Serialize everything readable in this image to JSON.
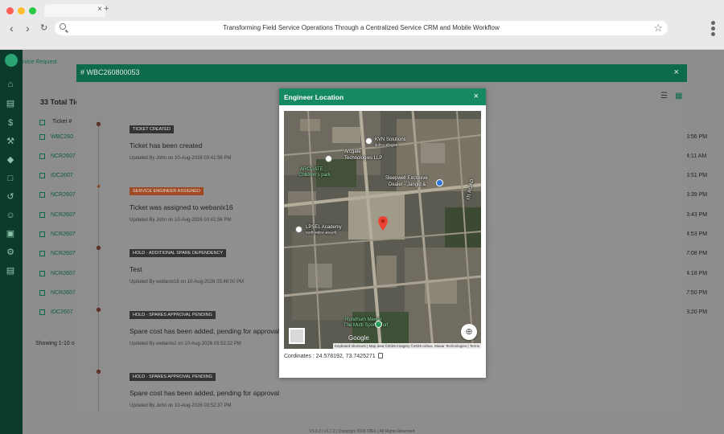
{
  "browser": {
    "page_title": "Transforming Field Service Operations Through a Centralized Service CRM and Mobile Workflow",
    "tab_close": "×",
    "new_tab": "+"
  },
  "background": {
    "header_fragment": "rvice Request",
    "total_label": "33 Total Tic",
    "ticket_col": "Ticket #",
    "rows": [
      "WBC260",
      "NCR2607",
      "IDC2607",
      "NCR2607",
      "NCR2607",
      "NCR2607",
      "NCR2607",
      "NCR2607",
      "NCR2607",
      "IDC2607"
    ],
    "times": [
      "3:56 PM",
      "4:11 AM",
      "3:51 PM",
      "3:39 PM",
      "3:43 PM",
      "4:53 PM",
      "7:08 PM",
      "4:18 PM",
      "7:50 PM",
      "3:20 PM"
    ],
    "showing_text": "Showing 1-10 o",
    "footer": "V1.0.2   |   v1.7.2   |   Copyright 2026 IDEX   |   All Rights Reserved"
  },
  "ticket_modal": {
    "title": "# WBC260800053",
    "close": "×",
    "events": [
      {
        "badge": "TICKET CREATED",
        "text": "Ticket has been created",
        "meta": "Updated By John on 10-Aug-2026 03:41:56 PM",
        "style": "dark",
        "icon": "person-icon"
      },
      {
        "badge": "SERVICE ENGINEER ASSIGNED",
        "text": "Ticket was assigned to webanix16",
        "meta": "Updated By John on 10-Aug-2026 03:41:56 PM",
        "style": "orange",
        "icon": "check-circle-icon"
      },
      {
        "badge": "HOLD - ADDITIONAL SPARE DEPENDENCY",
        "text": "Test",
        "meta": "Updated By webanix16 on 10-Aug-2026 03:48:00 PM",
        "style": "dark",
        "icon": "person-icon"
      },
      {
        "badge": "HOLD - SPARES APPROVAL PENDING",
        "text": "Spare cost has been added, pending for approval",
        "meta": "Updated By webanix2 on 10-Aug-2026 03:52:22 PM",
        "style": "dark",
        "icon": "person-icon"
      },
      {
        "badge": "HOLD - SPARES APPROVAL PENDING",
        "text": "Spare cost has been added, pending for approval",
        "meta": "Updated By John on 10-Aug-2026 03:52:37 PM",
        "style": "dark",
        "icon": "person-icon"
      }
    ]
  },
  "location_modal": {
    "title": "Engineer Location",
    "close": "×",
    "coordinates_label": "Cordinates : 24.578192, 73.7425271",
    "map": {
      "places": [
        {
          "name": "KVN Solutions",
          "sub": "केवीएन सॉल्यूशंस"
        },
        {
          "name": "Arcgate",
          "sub": ""
        },
        {
          "name": "Technologies LLP",
          "sub": ""
        },
        {
          "name": "ARCGATE",
          "sub": ""
        },
        {
          "name": "Children's park",
          "sub": ""
        },
        {
          "name": "Sleepwell Exclusive",
          "sub": ""
        },
        {
          "name": "Dealer - Jangid &",
          "sub": ""
        },
        {
          "name": "ITI ROAD",
          "sub": ""
        },
        {
          "name": "LPSEL Academy",
          "sub": "एलपीएसईएल अकादमी"
        },
        {
          "name": "Rundhum Mewar",
          "sub": ""
        },
        {
          "name": "The Multi Sports Turf",
          "sub": ""
        }
      ],
      "google": "Google",
      "attribution": "Keyboard shortcuts  |  Map data ©2026 Imagery ©2026 Airbus, Maxar Technologies  |  Terms"
    }
  }
}
